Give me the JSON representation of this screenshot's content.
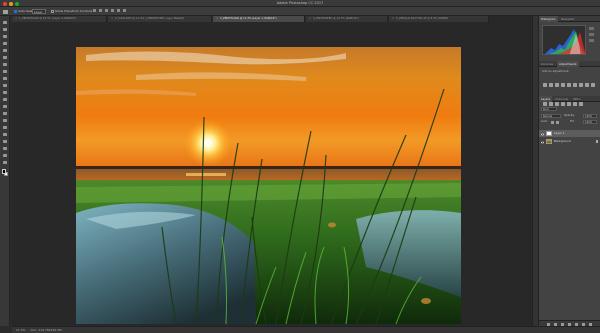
{
  "window": {
    "title": "Adobe Photoshop CC 2017"
  },
  "options_bar": {
    "auto_select_label": "Auto-Select:",
    "auto_select_value": "Layer",
    "transform_label": "Show Transform Controls"
  },
  "tabs": [
    {
      "label": "1_ZBDSDDAOR @ 10.3% (Layer 0, RGB/16*)",
      "active": false
    },
    {
      "label": "2_Unt3ohdt3 @ 11.3% (_DBDDDFLWE, Layer Mask/8)",
      "active": false
    },
    {
      "label": "3_ZBDDTLAKR @ 11.3% (Layer 1, RGB/16*)",
      "active": true
    },
    {
      "label": "4_ZSDODSEEH @ 12.3% (RGB/16*)",
      "active": false
    },
    {
      "label": "5_ZSDOLQ 460 F461.tif @ 8.3% (RGB/8)",
      "active": false
    }
  ],
  "toolbar": {
    "tools": [
      "move-tool",
      "marquee-tool",
      "lasso-tool",
      "quick-select-tool",
      "crop-tool",
      "eyedropper-tool",
      "healing-tool",
      "brush-tool",
      "clone-stamp-tool",
      "history-brush-tool",
      "eraser-tool",
      "gradient-tool",
      "blur-tool",
      "dodge-tool",
      "pen-tool",
      "type-tool",
      "path-select-tool",
      "rectangle-tool",
      "hand-tool",
      "zoom-tool",
      "edit-toolbar-tool"
    ],
    "foreground_color": "#000000",
    "background_color": "#ffffff"
  },
  "panels": {
    "top_tabs": [
      "Histogram",
      "Navigator"
    ],
    "mid_tabs": [
      "Libraries",
      "Adjustments"
    ],
    "adjustments_label": "Add an adjustment",
    "adjustment_icons": [
      "brightness-icon",
      "levels-icon",
      "curves-icon",
      "exposure-icon",
      "vibrance-icon",
      "hue-saturation-icon",
      "color-balance-icon",
      "black-white-icon",
      "photo-filter-icon",
      "channel-mixer-icon",
      "color-lookup-icon",
      "invert-icon",
      "posterize-icon",
      "threshold-icon",
      "gradient-map-icon",
      "selective-color-icon"
    ],
    "layers_tabs": [
      "Layers",
      "Channels",
      "Paths"
    ],
    "kind_label": "Kind",
    "blend_mode": "Normal",
    "opacity_label": "Opacity:",
    "opacity_value": "100%",
    "lock_label": "Lock:",
    "fill_label": "Fill:",
    "fill_value": "100%",
    "layers": [
      {
        "name": "Layer 1",
        "selected": true
      },
      {
        "name": "Background",
        "selected": false
      }
    ]
  },
  "status": {
    "zoom": "11.3%",
    "doc": "Doc: 219.7M/439.5M"
  },
  "colors": {
    "ui_dark": "#2b2b2b",
    "panel": "#434343",
    "accent_selected": "#5d5d5d"
  }
}
